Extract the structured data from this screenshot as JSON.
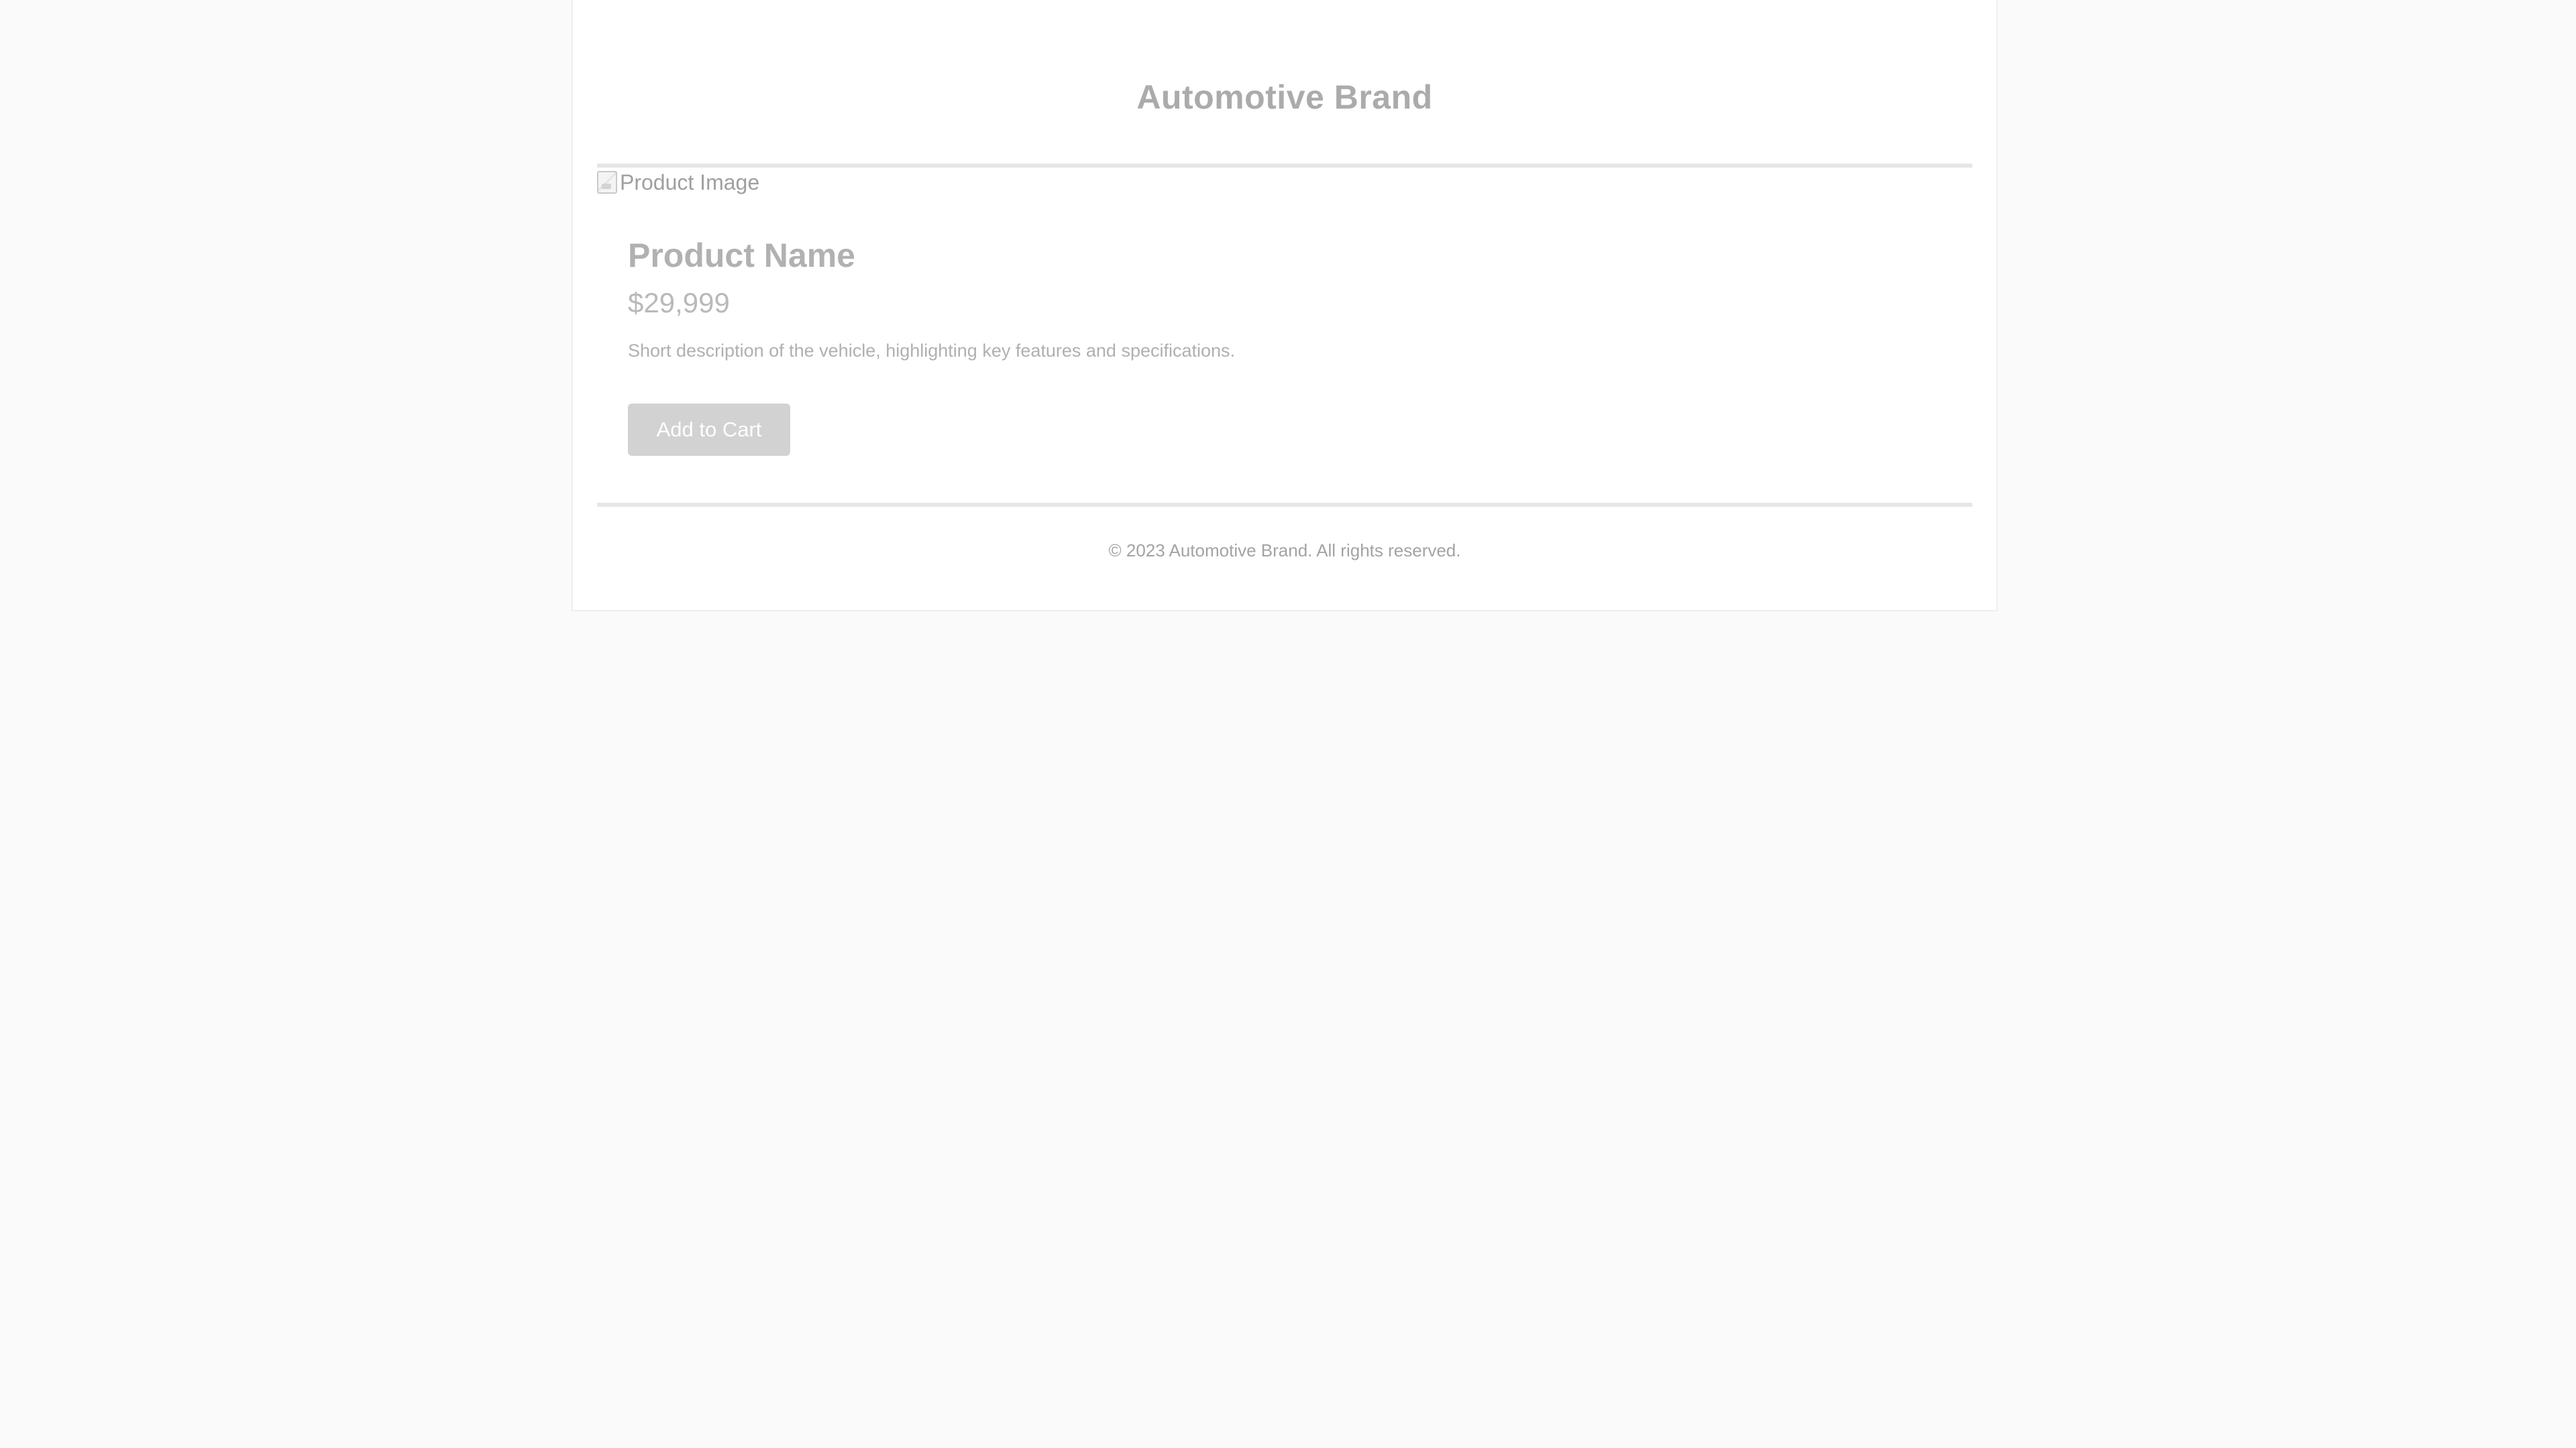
{
  "header": {
    "brand": "Automotive Brand"
  },
  "product": {
    "image_alt": "Product Image",
    "image_icon": "broken-image-icon",
    "name": "Product Name",
    "price": "$29,999",
    "description": "Short description of the vehicle, highlighting key features and specifications.",
    "add_to_cart_label": "Add to Cart"
  },
  "footer": {
    "copyright": "© 2023 Automotive Brand. All rights reserved."
  },
  "colors": {
    "background": "#fafafa",
    "card": "#ffffff",
    "divider": "#e6e6e6",
    "button": "#d2d2d2"
  }
}
